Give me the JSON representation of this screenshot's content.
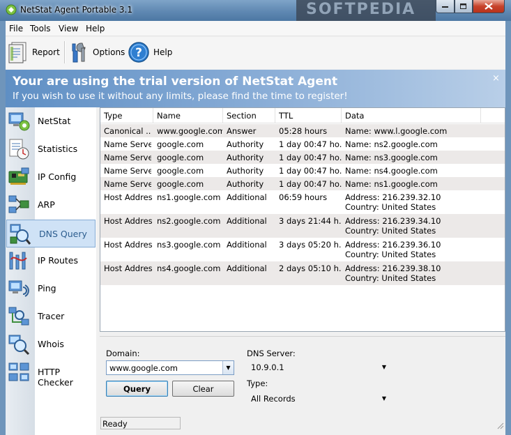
{
  "window": {
    "title": "NetStat Agent Portable 3.1",
    "watermark": "SOFTPEDIA"
  },
  "menu": {
    "file": "File",
    "tools": "Tools",
    "view": "View",
    "help": "Help"
  },
  "toolbar": {
    "report": "Report",
    "options": "Options",
    "help": "Help"
  },
  "banner": {
    "title": "Your are using the trial version of NetStat Agent",
    "subtitle": "If you wish to use it without any limits, please find the time to register!",
    "close": "×"
  },
  "sidebar": {
    "items": [
      {
        "label": "NetStat",
        "icon": "netstat-icon"
      },
      {
        "label": "Statistics",
        "icon": "statistics-icon"
      },
      {
        "label": "IP Config",
        "icon": "ip-config-icon"
      },
      {
        "label": "ARP",
        "icon": "arp-icon"
      },
      {
        "label": "DNS Query",
        "icon": "dns-query-icon",
        "active": true
      },
      {
        "label": "IP Routes",
        "icon": "ip-routes-icon"
      },
      {
        "label": "Ping",
        "icon": "ping-icon"
      },
      {
        "label": "Tracer",
        "icon": "tracer-icon"
      },
      {
        "label": "Whois",
        "icon": "whois-icon"
      },
      {
        "label": "HTTP Checker",
        "icon": "http-checker-icon"
      }
    ]
  },
  "table": {
    "columns": [
      "Type",
      "Name",
      "Section",
      "TTL",
      "Data"
    ],
    "rows": [
      {
        "type": "Canonical ...",
        "name": "www.google.com",
        "section": "Answer",
        "ttl": "05:28 hours",
        "data": [
          "Name: www.l.google.com"
        ]
      },
      {
        "type": "Name Server",
        "name": "google.com",
        "section": "Authority",
        "ttl": "1 day 00:47 ho...",
        "data": [
          "Name: ns2.google.com"
        ]
      },
      {
        "type": "Name Server",
        "name": "google.com",
        "section": "Authority",
        "ttl": "1 day 00:47 ho...",
        "data": [
          "Name: ns3.google.com"
        ]
      },
      {
        "type": "Name Server",
        "name": "google.com",
        "section": "Authority",
        "ttl": "1 day 00:47 ho...",
        "data": [
          "Name: ns4.google.com"
        ]
      },
      {
        "type": "Name Server",
        "name": "google.com",
        "section": "Authority",
        "ttl": "1 day 00:47 ho...",
        "data": [
          "Name: ns1.google.com"
        ]
      },
      {
        "type": "Host Address",
        "name": "ns1.google.com",
        "section": "Additional",
        "ttl": "06:59 hours",
        "data": [
          "Address: 216.239.32.10",
          "Country: United States"
        ]
      },
      {
        "type": "Host Address",
        "name": "ns2.google.com",
        "section": "Additional",
        "ttl": "3 days 21:44 h...",
        "data": [
          "Address: 216.239.34.10",
          "Country: United States"
        ]
      },
      {
        "type": "Host Address",
        "name": "ns3.google.com",
        "section": "Additional",
        "ttl": "3 days 05:20 h...",
        "data": [
          "Address: 216.239.36.10",
          "Country: United States"
        ]
      },
      {
        "type": "Host Address",
        "name": "ns4.google.com",
        "section": "Additional",
        "ttl": "2 days 05:10 h...",
        "data": [
          "Address: 216.239.38.10",
          "Country: United States"
        ]
      }
    ]
  },
  "query": {
    "domain_label": "Domain:",
    "domain_value": "www.google.com",
    "dns_server_label": "DNS Server:",
    "dns_server_value": "10.9.0.1",
    "type_label": "Type:",
    "type_value": "All Records",
    "query_button": "Query",
    "clear_button": "Clear"
  },
  "status": {
    "text": "Ready"
  },
  "colors": {
    "banner_start": "#5f8fc4",
    "active_nav": "#cfe2f6",
    "row_shade": "#ece9e8"
  }
}
